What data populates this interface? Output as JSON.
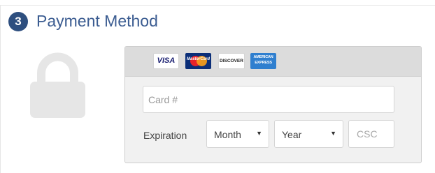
{
  "section": {
    "step_number": "3",
    "title": "Payment Method"
  },
  "icons": {
    "lock": "lock-icon",
    "lock_color": "#e6e6e6"
  },
  "card_logos": {
    "visa": "VISA",
    "mastercard": "MasterCard",
    "discover": "DISCOVER",
    "amex_line1": "AMERICAN",
    "amex_line2": "EXPRESS"
  },
  "form": {
    "card_number_placeholder": "Card #",
    "card_number_value": "",
    "expiration_label": "Expiration",
    "month_value": "Month",
    "year_value": "Year",
    "csc_placeholder": "CSC",
    "csc_value": ""
  },
  "colors": {
    "title": "#3b5c91",
    "badge": "#2e4f7f",
    "panel_header": "#dcdcdc",
    "panel_body": "#f1f1f1"
  }
}
